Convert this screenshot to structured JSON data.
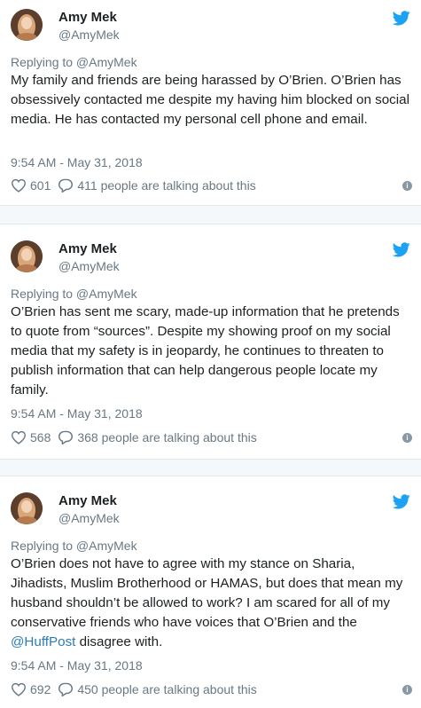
{
  "colors": {
    "handle": "#697882",
    "link": "#2b7bb9",
    "bird": "#1da1f2",
    "separator": "#f5f8fa"
  },
  "tweets": [
    {
      "author": "Amy Mek",
      "handle": "@AmyMek",
      "replying_to": "Replying to @AmyMek",
      "text_parts": [
        "My family and friends are being harassed by O’Brien. O’Brien has obsessively contacted me despite my having him blocked on social media. He has contacted my personal cell phone and email."
      ],
      "timestamp": "9:54 AM - May 31, 2018",
      "likes": "601",
      "talking": "411 people are talking about this"
    },
    {
      "author": "Amy Mek",
      "handle": "@AmyMek",
      "replying_to": "Replying to @AmyMek",
      "text_parts": [
        "O’Brien has sent me scary, made-up information that he pretends to quote from “sources”. Despite my showing proof on my social media that my safety is in jeopardy, he continues to threaten to publish information that can help dangerous people locate my family."
      ],
      "timestamp": "9:54 AM - May 31, 2018",
      "likes": "568",
      "talking": "368 people are talking about this"
    },
    {
      "author": "Amy Mek",
      "handle": "@AmyMek",
      "replying_to": "Replying to @AmyMek",
      "text_parts": [
        "O’Brien does not have to agree with my stance on Sharia, Jihadists, Muslim Brotherhood or HAMAS, but does that mean my husband shouldn’t be allowed to work?  I am scared for all of my conservative friends who have voices that O’Brien and the ",
        "@HuffPost",
        " disagree with."
      ],
      "timestamp": "9:54 AM - May 31, 2018",
      "likes": "692",
      "talking": "450 people are talking about this"
    }
  ]
}
